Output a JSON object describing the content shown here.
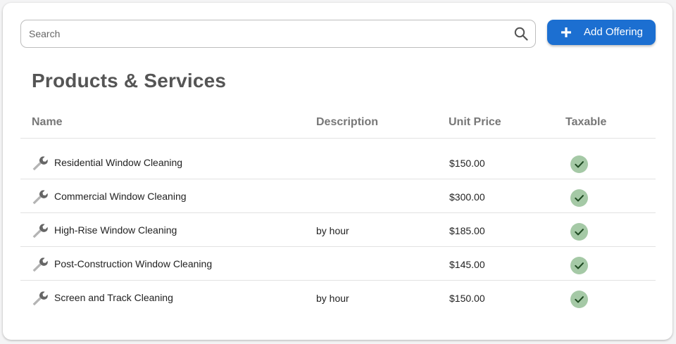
{
  "search": {
    "placeholder": "Search",
    "value": ""
  },
  "actions": {
    "add_label": "Add Offering"
  },
  "page": {
    "title": "Products & Services"
  },
  "table": {
    "columns": [
      "Name",
      "Description",
      "Unit Price",
      "Taxable"
    ],
    "rows": [
      {
        "name": "Residential Window Cleaning",
        "description": "",
        "unit_price": "$150.00",
        "taxable": true
      },
      {
        "name": "Commercial Window Cleaning",
        "description": "",
        "unit_price": "$300.00",
        "taxable": true
      },
      {
        "name": "High-Rise Window Cleaning",
        "description": "by hour",
        "unit_price": "$185.00",
        "taxable": true
      },
      {
        "name": "Post-Construction Window Cleaning",
        "description": "",
        "unit_price": "$145.00",
        "taxable": true
      },
      {
        "name": "Screen and Track Cleaning",
        "description": "by hour",
        "unit_price": "$150.00",
        "taxable": true
      }
    ]
  },
  "icons": {
    "search": "search-icon",
    "add": "plus-icon",
    "row": "wrench-icon",
    "taxable": "check-circle-icon"
  },
  "colors": {
    "accent": "#1c6fd1",
    "check_bg": "#a5c9a6",
    "check_fg": "#1f4a22"
  }
}
